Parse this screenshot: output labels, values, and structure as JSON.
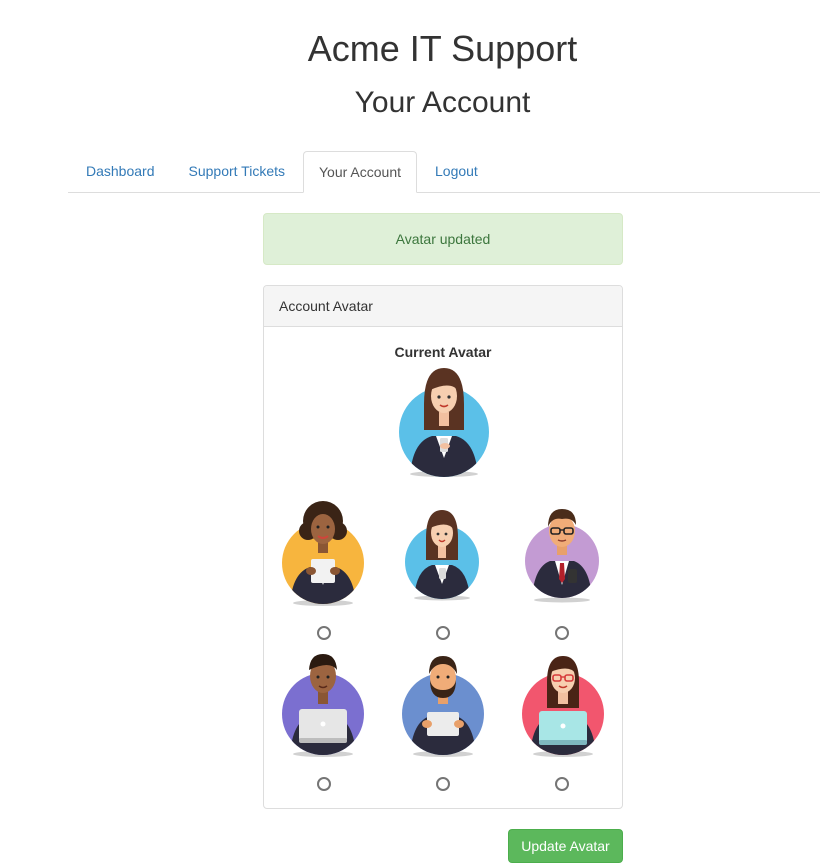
{
  "header": {
    "site_title": "Acme IT Support",
    "page_title": "Your Account"
  },
  "nav": {
    "tabs": [
      {
        "label": "Dashboard",
        "active": false
      },
      {
        "label": "Support Tickets",
        "active": false
      },
      {
        "label": "Your Account",
        "active": true
      },
      {
        "label": "Logout",
        "active": false
      }
    ]
  },
  "alert": {
    "message": "Avatar updated",
    "type": "success"
  },
  "panel": {
    "heading": "Account Avatar",
    "current_label": "Current Avatar",
    "current_avatar": "avatar-woman-brown-hair-blue-bg",
    "options": [
      {
        "name": "avatar-woman-curly-hair-orange-bg",
        "selected": false
      },
      {
        "name": "avatar-woman-brown-hair-blue-bg",
        "selected": false
      },
      {
        "name": "avatar-man-glasses-purple-bg",
        "selected": false
      },
      {
        "name": "avatar-man-laptop-indigo-bg",
        "selected": false
      },
      {
        "name": "avatar-man-beard-blue-bg",
        "selected": false
      },
      {
        "name": "avatar-woman-glasses-red-bg",
        "selected": false
      }
    ]
  },
  "form": {
    "submit_label": "Update Avatar"
  },
  "colors": {
    "link": "#337ab7",
    "success_bg": "#dff0d8",
    "success_text": "#3c763d",
    "button": "#5cb85c"
  }
}
